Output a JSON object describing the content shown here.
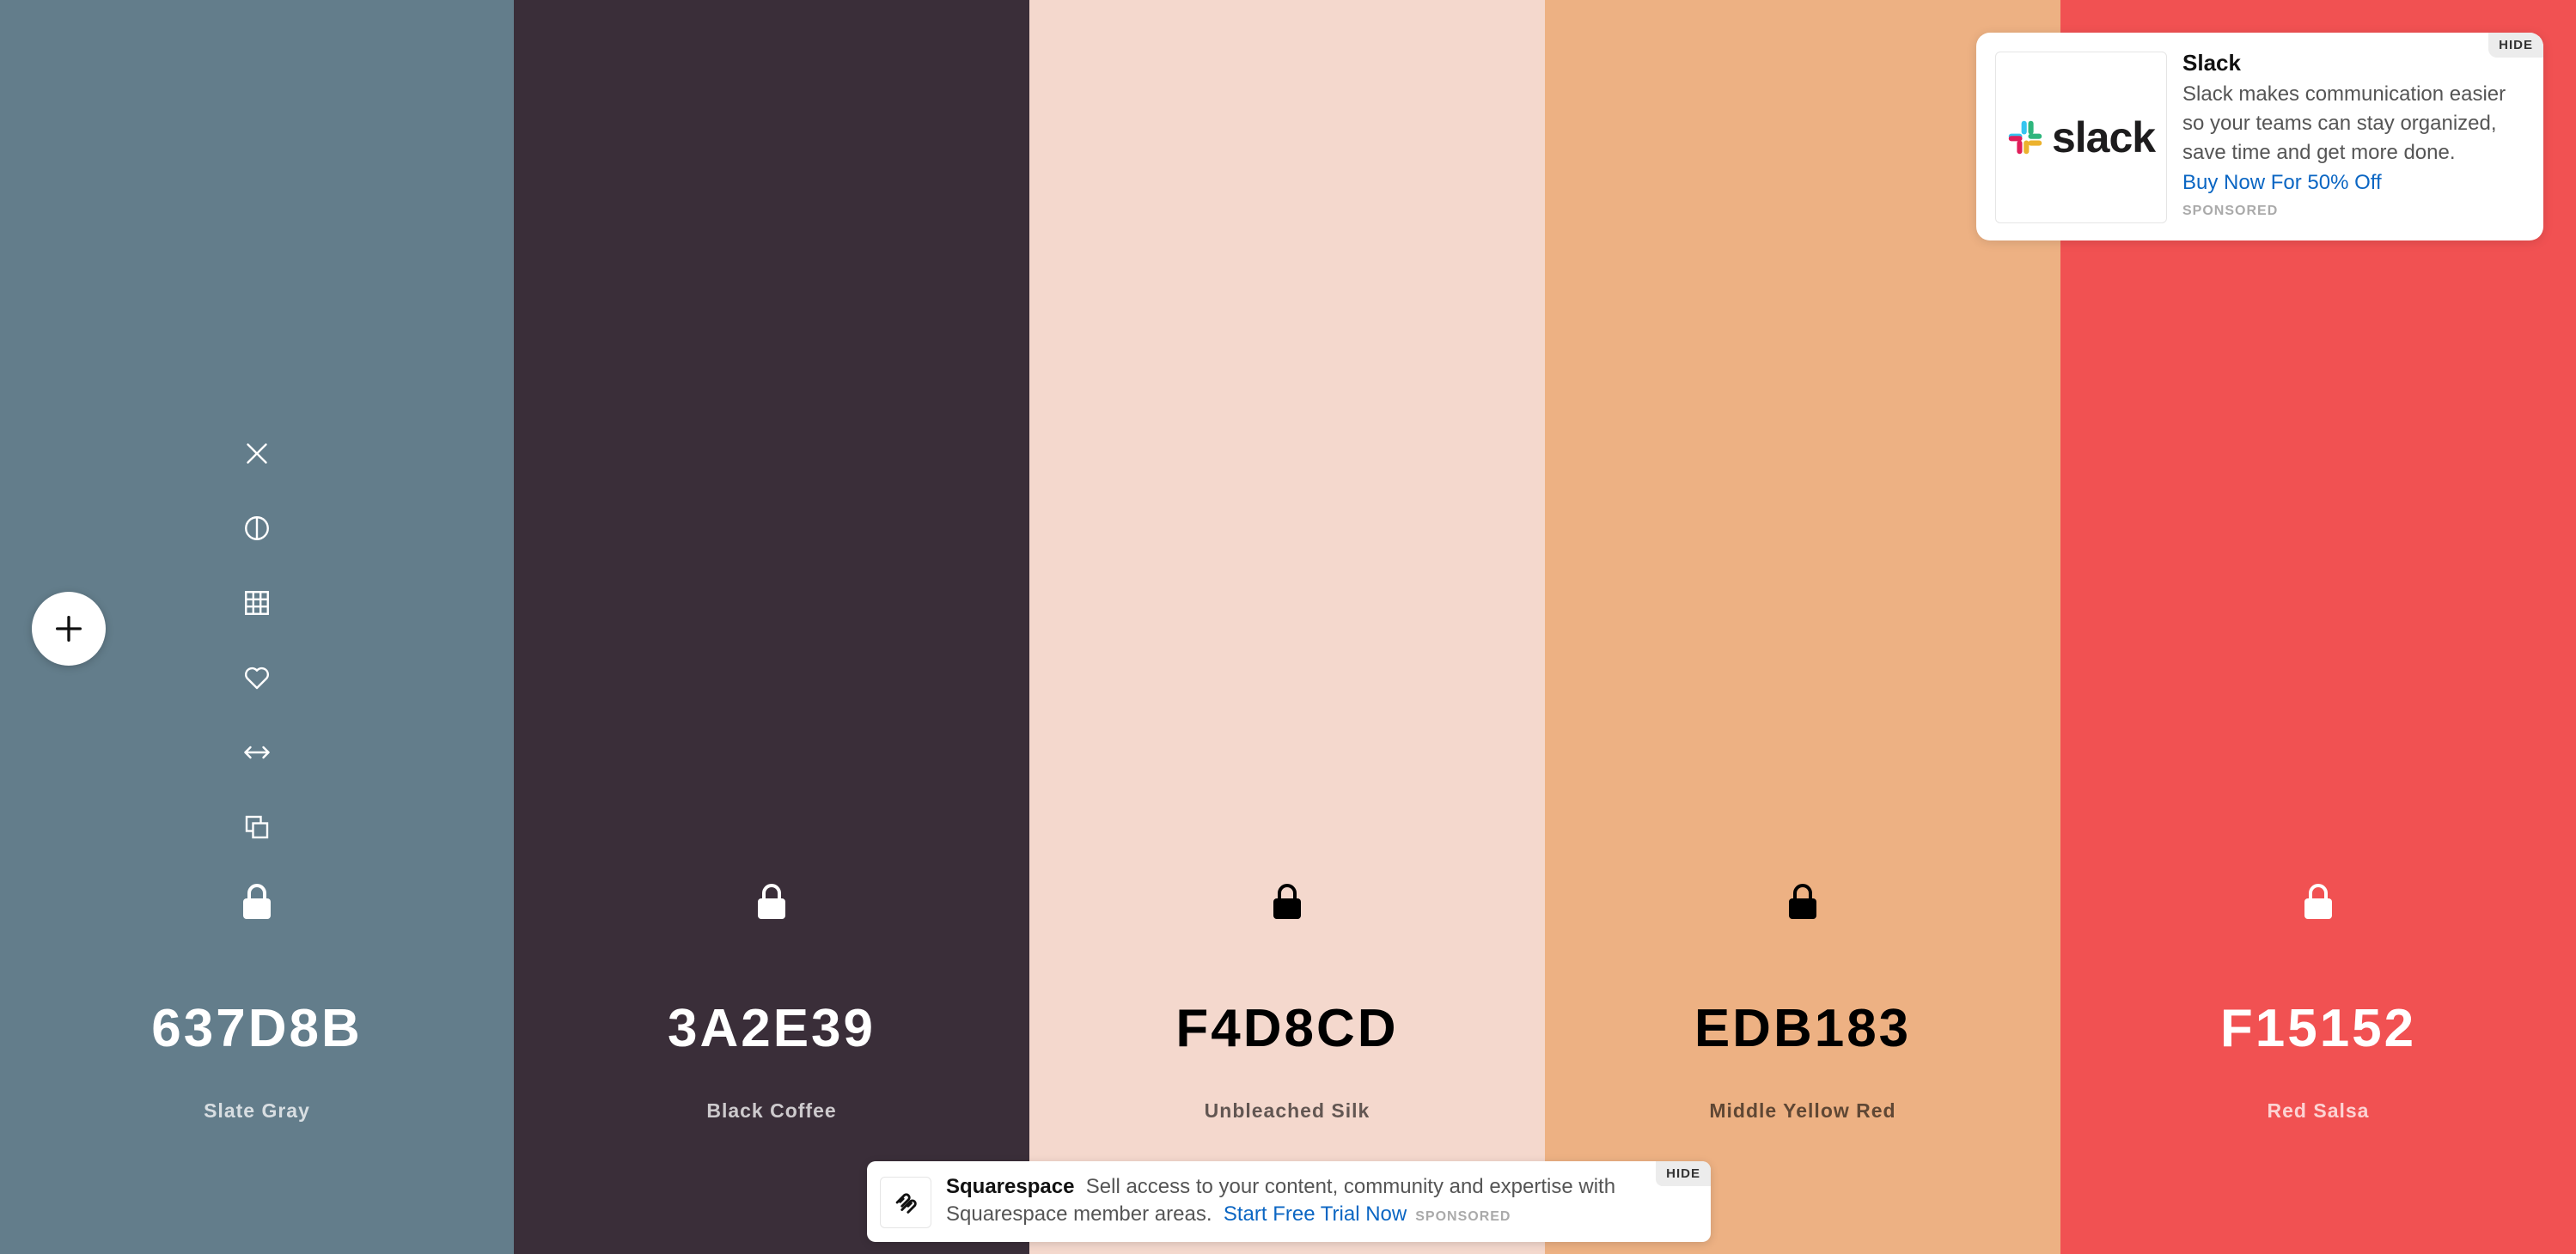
{
  "colors": [
    {
      "hex": "637D8B",
      "name": "Slate Gray",
      "bg": "#637D8B",
      "fg": "#FFFFFF",
      "sub": "rgba(255,255,255,0.75)",
      "icon": "#FFFFFF"
    },
    {
      "hex": "3A2E39",
      "name": "Black Coffee",
      "bg": "#3A2E39",
      "fg": "#FFFFFF",
      "sub": "rgba(255,255,255,0.75)",
      "icon": "#FFFFFF"
    },
    {
      "hex": "F4D8CD",
      "name": "Unbleached Silk",
      "bg": "#F4D8CD",
      "fg": "#000000",
      "sub": "rgba(0,0,0,0.6)",
      "icon": "#000000"
    },
    {
      "hex": "EDB183",
      "name": "Middle Yellow Red",
      "bg": "#EDB183",
      "fg": "#000000",
      "sub": "rgba(0,0,0,0.6)",
      "icon": "#000000"
    },
    {
      "hex": "F15152",
      "name": "Red Salsa",
      "bg": "#F15152",
      "fg": "#FFFFFF",
      "sub": "rgba(255,255,255,0.75)",
      "icon": "#FFFFFF"
    }
  ],
  "toolbar_icons": [
    "close-icon",
    "contrast-icon",
    "grid-icon",
    "heart-icon",
    "drag-arrows-icon",
    "copy-icon",
    "lock-icon"
  ],
  "ad_card": {
    "title": "Slack",
    "body": "Slack makes communication easier so your teams can stay organized, save time and get more done.",
    "cta": "Buy Now For 50% Off",
    "sponsored": "SPONSORED",
    "hide": "HIDE",
    "logo_text": "slack"
  },
  "ad_bar": {
    "brand": "Squarespace",
    "body": "Sell access to your content, community and expertise with Squarespace member areas.",
    "cta": "Start Free Trial Now",
    "sponsored": "SPONSORED",
    "hide": "HIDE"
  }
}
